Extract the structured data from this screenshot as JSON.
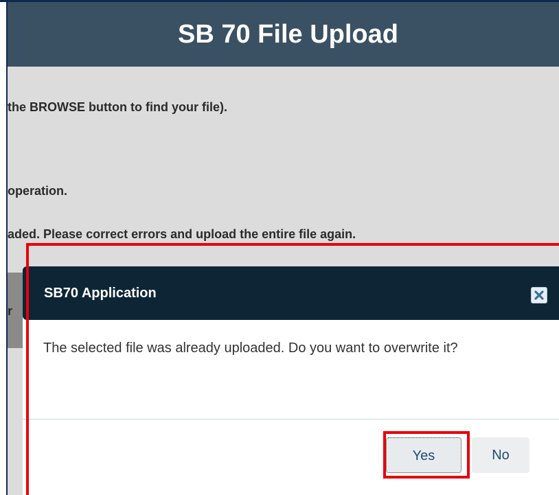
{
  "page": {
    "title": "SB 70 File Upload"
  },
  "instructions": {
    "line1": "the BROWSE button to find your file).",
    "line2": "operation.",
    "line3": "aded. Please correct errors and upload the entire file again.",
    "peek_char": "r"
  },
  "dialog": {
    "title": "SB70 Application",
    "close_icon": "close-icon",
    "message": "The selected file was already uploaded. Do you want to overwrite it?",
    "yes_label": "Yes",
    "no_label": "No"
  },
  "colors": {
    "title_bar": "#3a5163",
    "dialog_header": "#0e2536",
    "highlight": "#e8000b",
    "button_text": "#1f4c72"
  }
}
